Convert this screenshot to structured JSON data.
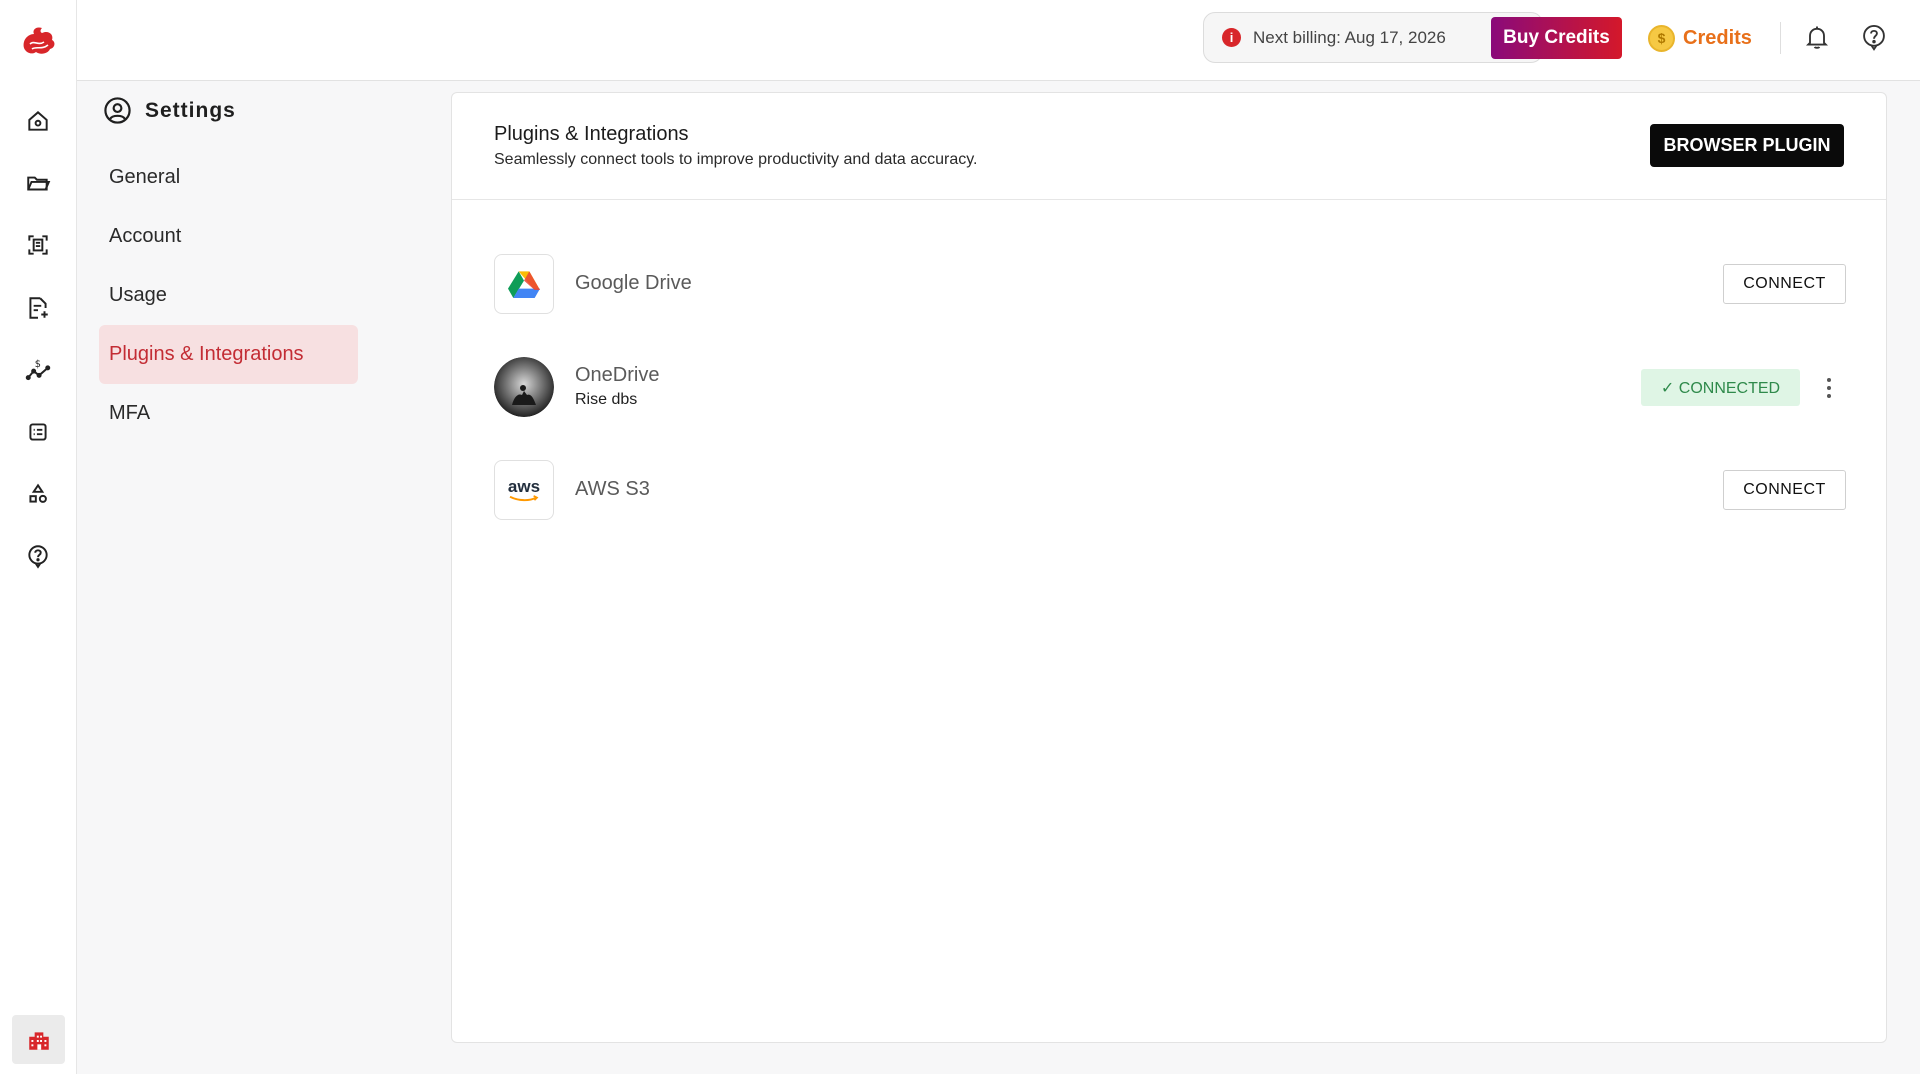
{
  "colors": {
    "accent": "#c32c34",
    "active_bg": "#f7e0e1",
    "credits_orange": "#e8701a",
    "connected_green": "#2f8a4b",
    "connected_bg": "#dff5e5"
  },
  "rail": {
    "logo": "brand-logo",
    "items": [
      {
        "icon": "home-icon"
      },
      {
        "icon": "folder-icon"
      },
      {
        "icon": "scan-document-icon"
      },
      {
        "icon": "add-document-icon"
      },
      {
        "icon": "finance-chart-icon"
      },
      {
        "icon": "list-icon"
      },
      {
        "icon": "shapes-icon"
      },
      {
        "icon": "help-circle-icon"
      }
    ],
    "bottom_icon": "building-icon"
  },
  "header": {
    "billing_text": "Next billing: Aug 17, 2026",
    "buy_credits_label": "Buy Credits",
    "credits_label": "Credits",
    "coin_symbol": "$"
  },
  "settings": {
    "title": "Settings",
    "nav": [
      {
        "label": "General",
        "active": false
      },
      {
        "label": "Account",
        "active": false
      },
      {
        "label": "Usage",
        "active": false
      },
      {
        "label": "Plugins & Integrations",
        "active": true
      },
      {
        "label": "MFA",
        "active": false
      }
    ]
  },
  "main": {
    "title": "Plugins & Integrations",
    "subtitle": "Seamlessly connect tools to improve productivity and data accuracy.",
    "browser_plugin_label": "BROWSER PLUGIN",
    "integrations": [
      {
        "name": "Google Drive",
        "subtitle": "",
        "status": "disconnected",
        "button_label": "CONNECT",
        "icon": "google-drive-icon"
      },
      {
        "name": "OneDrive",
        "subtitle": "Rise dbs",
        "status": "connected",
        "badge_label": "✓ CONNECTED",
        "icon": "onedrive-avatar"
      },
      {
        "name": "AWS S3",
        "subtitle": "",
        "status": "disconnected",
        "button_label": "CONNECT",
        "icon": "aws-icon",
        "logo_text": "aws"
      }
    ]
  }
}
